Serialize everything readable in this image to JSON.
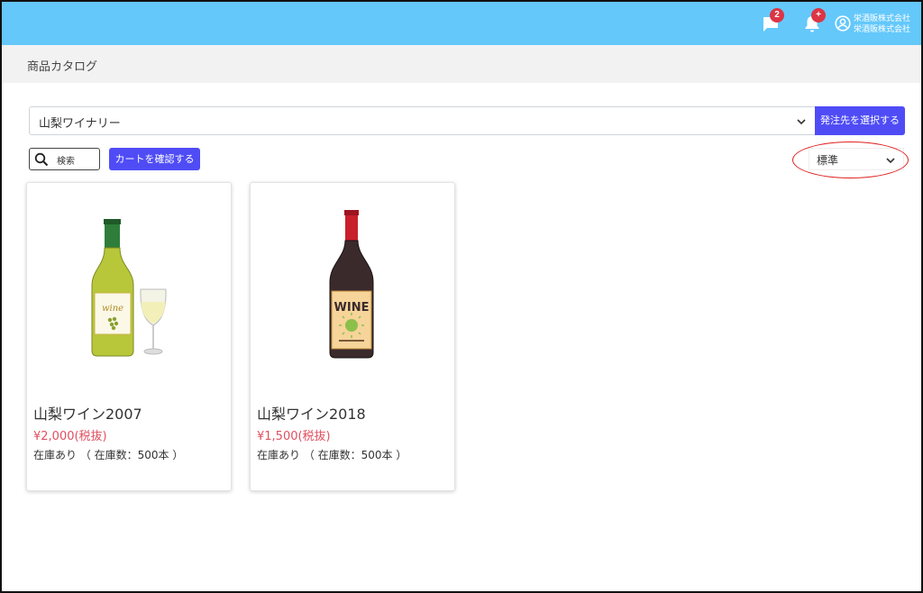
{
  "header": {
    "message_badge": "2",
    "notification_badge": "+",
    "company_line1": "栄酒販株式会社",
    "company_line2": "栄酒販株式会社"
  },
  "page": {
    "title": "商品カタログ"
  },
  "supplier": {
    "selected": "山梨ワイナリー",
    "select_button": "発注先を選択する"
  },
  "toolbar": {
    "search_label": "検索",
    "cart_button": "カートを確認する",
    "sort_selected": "標準"
  },
  "products": [
    {
      "name": "山梨ワイン2007",
      "price": "¥2,000(税抜)",
      "stock": "在庫あり （ 在庫数：500本 ）",
      "label_text": "wine"
    },
    {
      "name": "山梨ワイン2018",
      "price": "¥1,500(税抜)",
      "stock": "在庫あり （ 在庫数：500本 ）",
      "label_text": "WINE"
    }
  ],
  "colors": {
    "header": "#64c8fb",
    "primary": "#4f4cf6",
    "price": "#e05060",
    "highlight": "#e0201e"
  }
}
